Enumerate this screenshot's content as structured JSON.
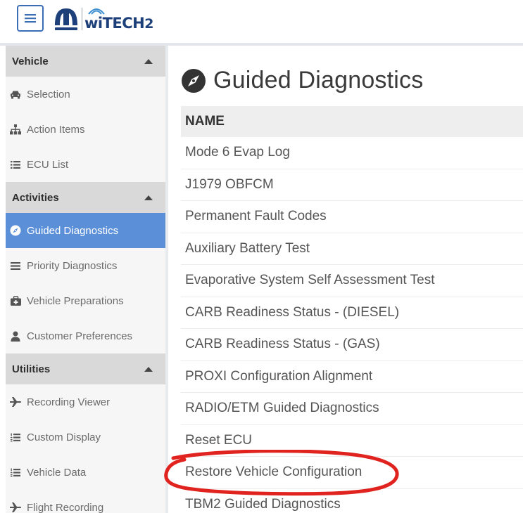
{
  "header": {
    "menu_icon": "hamburger-icon",
    "brand": {
      "mopar_logo": "mopar-logo",
      "witech_name": "wiTECH",
      "witech_version": "2"
    }
  },
  "sidebar": {
    "sections": [
      {
        "title": "Vehicle",
        "items": [
          {
            "label": "Selection",
            "icon": "car-icon"
          },
          {
            "label": "Action Items",
            "icon": "sitemap-icon"
          },
          {
            "label": "ECU List",
            "icon": "list-icon"
          }
        ]
      },
      {
        "title": "Activities",
        "items": [
          {
            "label": "Guided Diagnostics",
            "icon": "compass-icon",
            "active": true
          },
          {
            "label": "Priority Diagnostics",
            "icon": "lines-icon"
          },
          {
            "label": "Vehicle Preparations",
            "icon": "medkit-icon"
          },
          {
            "label": "Customer Preferences",
            "icon": "user-icon"
          }
        ]
      },
      {
        "title": "Utilities",
        "items": [
          {
            "label": "Recording Viewer",
            "icon": "plane-icon"
          },
          {
            "label": "Custom Display",
            "icon": "numbered-list-icon"
          },
          {
            "label": "Vehicle Data",
            "icon": "numbered-list-icon"
          },
          {
            "label": "Flight Recording",
            "icon": "plane-icon"
          }
        ]
      }
    ]
  },
  "main": {
    "title": "Guided Diagnostics",
    "title_icon": "compass-icon",
    "table": {
      "header": "NAME",
      "rows": [
        "Mode 6 Evap Log",
        "J1979 OBFCM",
        "Permanent Fault Codes",
        "Auxiliary Battery Test",
        "Evaporative System Self Assessment Test",
        "CARB Readiness Status - (DIESEL)",
        "CARB Readiness Status - (GAS)",
        "PROXI Configuration Alignment",
        "RADIO/ETM Guided Diagnostics",
        "Reset ECU",
        "Restore Vehicle Configuration",
        "TBM2 Guided Diagnostics"
      ]
    }
  },
  "colors": {
    "active_item": "#5b8fd8",
    "brand_blue": "#1d3f7a",
    "menu_border": "#3b6fb5",
    "annotation_ring": "#e0231e"
  }
}
